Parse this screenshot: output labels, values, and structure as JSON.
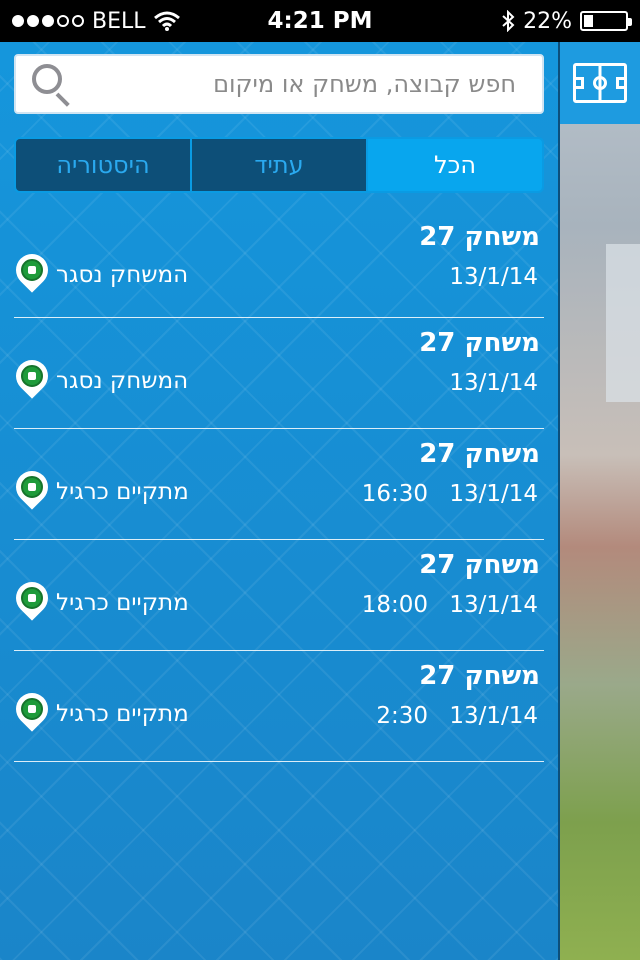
{
  "status_bar": {
    "carrier": "BELL",
    "time": "4:21 PM",
    "battery": "22%",
    "battery_level": 0.22,
    "signal_bars": 3
  },
  "search": {
    "placeholder": "חפש קבוצה, משחק או מיקום",
    "value": ""
  },
  "tabs": [
    {
      "label": "הכל",
      "active": true
    },
    {
      "label": "עתיד",
      "active": false
    },
    {
      "label": "היסטוריה",
      "active": false
    }
  ],
  "games": [
    {
      "title": "משחק 27",
      "date": "13/1/14",
      "time": "",
      "status": "המשחק נסגר"
    },
    {
      "title": "משחק 27",
      "date": "13/1/14",
      "time": "",
      "status": "המשחק נסגר"
    },
    {
      "title": "משחק 27",
      "date": "13/1/14",
      "time": "16:30",
      "status": "מתקיים כרגיל"
    },
    {
      "title": "משחק 27",
      "date": "13/1/14",
      "time": "18:00",
      "status": "מתקיים כרגיל"
    },
    {
      "title": "משחק 27",
      "date": "13/1/14",
      "time": "2:30",
      "status": "מתקיים כרגיל"
    }
  ],
  "colors": {
    "panel": "#1a8fd6",
    "tab_active": "#08a6ee",
    "tab_inactive": "#0d4f78",
    "pin_ball": "#1f9b3a"
  },
  "icons": {
    "search": "search-icon",
    "field": "soccer-field-icon",
    "pin": "soccer-ball-pin-icon"
  }
}
